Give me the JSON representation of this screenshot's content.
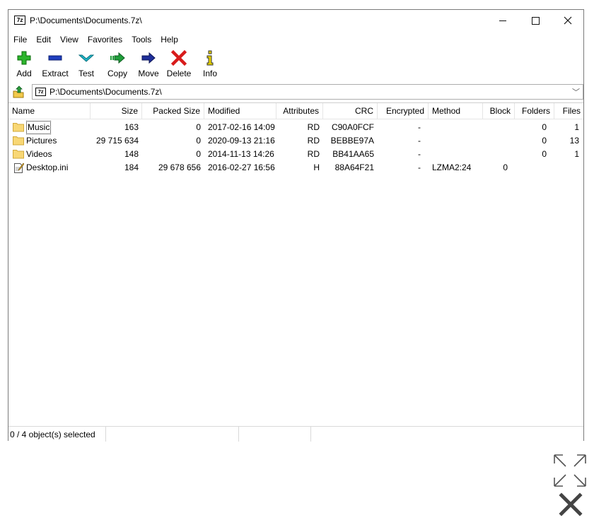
{
  "window": {
    "title": "P:\\Documents\\Documents.7z\\",
    "app_icon_text": "7z"
  },
  "menu": [
    "File",
    "Edit",
    "View",
    "Favorites",
    "Tools",
    "Help"
  ],
  "toolbar": [
    {
      "label": "Add",
      "icon": "add-icon",
      "color": "#2db52d"
    },
    {
      "label": "Extract",
      "icon": "extract-icon",
      "color": "#1f3fbf"
    },
    {
      "label": "Test",
      "icon": "test-icon",
      "color": "#1fb6c9"
    },
    {
      "label": "Copy",
      "icon": "copy-icon",
      "color": "#1f9e3a"
    },
    {
      "label": "Move",
      "icon": "move-icon",
      "color": "#1f2f9a"
    },
    {
      "label": "Delete",
      "icon": "delete-icon",
      "color": "#d81b1b"
    },
    {
      "label": "Info",
      "icon": "info-icon",
      "color": "#c8b400"
    }
  ],
  "address": {
    "path": "P:\\Documents\\Documents.7z\\",
    "icon_text": "7z"
  },
  "columns": [
    "Name",
    "Size",
    "Packed Size",
    "Modified",
    "Attributes",
    "CRC",
    "Encrypted",
    "Method",
    "Block",
    "Folders",
    "Files"
  ],
  "rows": [
    {
      "name": "Music",
      "type": "folder",
      "size": "163",
      "packed": "0",
      "modified": "2017-02-16 14:09",
      "attributes": "RD",
      "crc": "C90A0FCF",
      "encrypted": "-",
      "method": "",
      "block": "",
      "folders": "0",
      "files": "1"
    },
    {
      "name": "Pictures",
      "type": "folder",
      "size": "29 715 634",
      "packed": "0",
      "modified": "2020-09-13 21:16",
      "attributes": "RD",
      "crc": "BEBBE97A",
      "encrypted": "-",
      "method": "",
      "block": "",
      "folders": "0",
      "files": "13"
    },
    {
      "name": "Videos",
      "type": "folder",
      "size": "148",
      "packed": "0",
      "modified": "2014-11-13 14:26",
      "attributes": "RD",
      "crc": "BB41AA65",
      "encrypted": "-",
      "method": "",
      "block": "",
      "folders": "0",
      "files": "1"
    },
    {
      "name": "Desktop.ini",
      "type": "file",
      "size": "184",
      "packed": "29 678 656",
      "modified": "2016-02-27 16:56",
      "attributes": "H",
      "crc": "88A64F21",
      "encrypted": "-",
      "method": "LZMA2:24",
      "block": "0",
      "folders": "",
      "files": ""
    }
  ],
  "status": {
    "selection": "0 / 4 object(s) selected"
  },
  "overlay": {
    "expand_icon": "expand-arrows-icon",
    "close_icon": "close-icon"
  }
}
